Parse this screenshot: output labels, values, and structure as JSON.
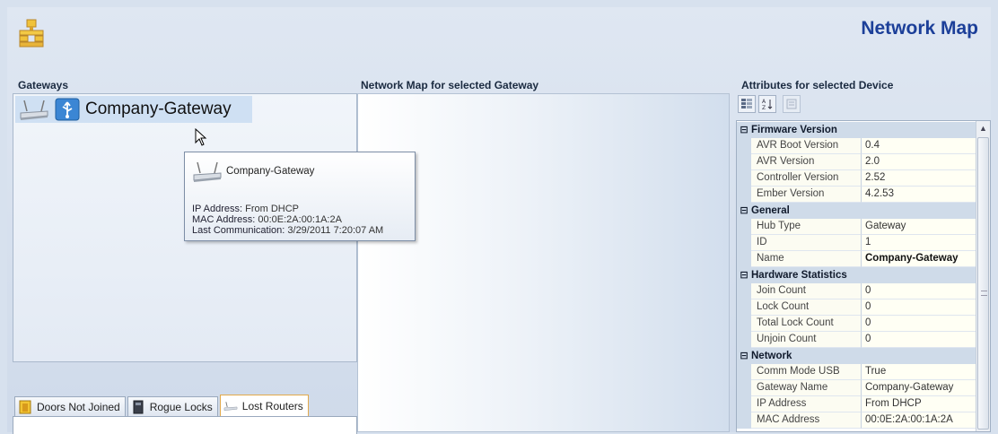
{
  "app": {
    "title": "Network Map",
    "icon": "network-app-icon"
  },
  "sections": {
    "gateways": "Gateways",
    "network_map": "Network Map for selected Gateway",
    "attributes": "Attributes for selected Device"
  },
  "gateway_list": {
    "items": [
      {
        "name": "Company-Gateway",
        "icons": [
          "router-icon",
          "usb-icon"
        ]
      }
    ]
  },
  "tooltip": {
    "title": "Company-Gateway",
    "ip_label": "IP Address:",
    "ip_value": "From DHCP",
    "mac_label": "MAC Address:",
    "mac_value": "00:0E:2A:00:1A:2A",
    "comm_label": "Last Communication:",
    "comm_value": "3/29/2011 7:20:07 AM"
  },
  "tabs": [
    {
      "label": "Doors Not Joined",
      "icon": "door-icon",
      "active": false
    },
    {
      "label": "Rogue Locks",
      "icon": "lock-icon",
      "active": false
    },
    {
      "label": "Lost Routers",
      "icon": "router-icon",
      "active": true
    }
  ],
  "attributes": {
    "categories": [
      {
        "name": "Firmware Version",
        "expander": "⊟",
        "props": [
          {
            "name": "AVR Boot Version",
            "value": "0.4"
          },
          {
            "name": "AVR Version",
            "value": "2.0"
          },
          {
            "name": "Controller Version",
            "value": "2.52"
          },
          {
            "name": "Ember Version",
            "value": "4.2.53"
          }
        ]
      },
      {
        "name": "General",
        "expander": "⊟",
        "props": [
          {
            "name": "Hub Type",
            "value": "Gateway"
          },
          {
            "name": "ID",
            "value": "1"
          },
          {
            "name": "Name",
            "value": "Company-Gateway",
            "bold": true
          }
        ]
      },
      {
        "name": "Hardware Statistics",
        "expander": "⊟",
        "props": [
          {
            "name": "Join Count",
            "value": "0"
          },
          {
            "name": "Lock Count",
            "value": "0"
          },
          {
            "name": "Total Lock Count",
            "value": "0"
          },
          {
            "name": "Unjoin Count",
            "value": "0"
          }
        ]
      },
      {
        "name": "Network",
        "expander": "⊟",
        "props": [
          {
            "name": "Comm Mode USB",
            "value": "True"
          },
          {
            "name": "Gateway Name",
            "value": "Company-Gateway"
          },
          {
            "name": "IP Address",
            "value": "From DHCP"
          },
          {
            "name": "MAC Address",
            "value": "00:0E:2A:00:1A:2A"
          }
        ]
      }
    ],
    "toolbar": [
      "categorized-icon",
      "alphabetical-icon",
      "property-pages-icon"
    ]
  }
}
